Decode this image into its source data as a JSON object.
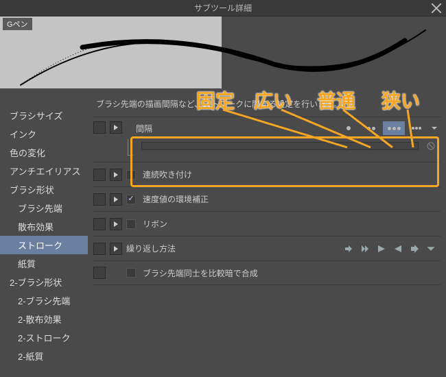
{
  "window": {
    "title": "サブツール詳細",
    "tool_name": "Gペン"
  },
  "sidebar": {
    "items": [
      {
        "label": "ブラシサイズ",
        "sub": false
      },
      {
        "label": "インク",
        "sub": false
      },
      {
        "label": "色の変化",
        "sub": false
      },
      {
        "label": "アンチエイリアス",
        "sub": false
      },
      {
        "label": "ブラシ形状",
        "sub": false
      },
      {
        "label": "ブラシ先端",
        "sub": true
      },
      {
        "label": "散布効果",
        "sub": true
      },
      {
        "label": "ストローク",
        "sub": true,
        "selected": true
      },
      {
        "label": "紙質",
        "sub": true
      },
      {
        "label": "2-ブラシ形状",
        "sub": false
      },
      {
        "label": "2-ブラシ先端",
        "sub": true
      },
      {
        "label": "2-散布効果",
        "sub": true
      },
      {
        "label": "2-ストローク",
        "sub": true
      },
      {
        "label": "2-紙質",
        "sub": true
      }
    ]
  },
  "main": {
    "description": "ブラシ先端の描画間隔など、ストロークに関する設定を行います。",
    "rows": {
      "spacing": {
        "label": "間隔"
      },
      "continuous": {
        "label": "連続吹き付け"
      },
      "velocity": {
        "label": "速度値の環境補正",
        "checked": true
      },
      "ribbon": {
        "label": "リボン"
      },
      "repeat": {
        "label": "繰り返し方法"
      },
      "blend": {
        "label": "ブラシ先端同士を比較暗で合成"
      }
    }
  },
  "annotations": {
    "a1": "固定",
    "a2": "広い",
    "a3": "普通",
    "a4": "狭い"
  }
}
